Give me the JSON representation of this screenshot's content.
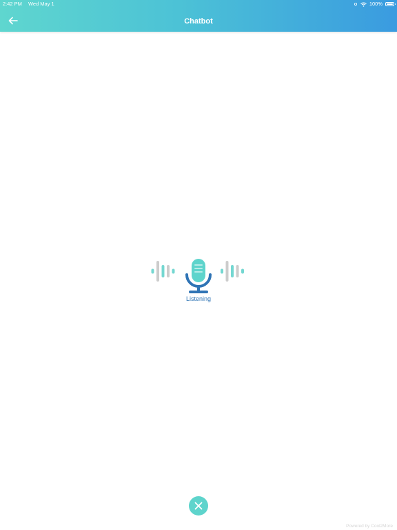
{
  "status_bar": {
    "time": "2:42 PM",
    "date": "Wed May 1",
    "battery": "100%"
  },
  "header": {
    "title": "Chatbot"
  },
  "listening": {
    "label": "Listening"
  },
  "footer": {
    "credit": "Powered by Cool2More"
  },
  "colors": {
    "header_gradient_start": "#5fd6cf",
    "header_gradient_end": "#3a9be0",
    "mic_head": "#5ed4cc",
    "mic_stand": "#2f74b5",
    "wave_teal": "#74d7d1",
    "wave_gray": "#cccccc",
    "close_button": "#5ed4cc",
    "listening_text": "#2f74b5"
  },
  "icons": {
    "back": "arrow-left-icon",
    "microphone": "microphone-icon",
    "close": "close-icon",
    "wifi": "wifi-icon",
    "battery": "battery-icon",
    "signal": "signal-icon"
  }
}
